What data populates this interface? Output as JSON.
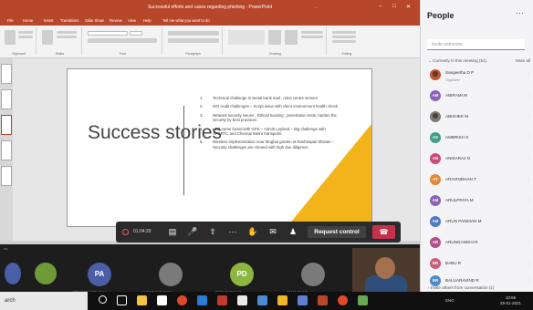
{
  "powerpoint": {
    "title": "Successful efforts and cases regarding phishing - PowerPoint",
    "user": "...",
    "tabs": [
      "Home",
      "Insert",
      "Transitions",
      "Slide Show",
      "Review",
      "View",
      "Help",
      "Tell me what you want to do"
    ],
    "ribbon_groups": [
      "Clipboard",
      "Slides",
      "Font",
      "Paragraph",
      "Drawing",
      "Editing"
    ]
  },
  "slide": {
    "title": "Success stories",
    "accent_color": "#f3b41b",
    "items": [
      {
        "num": "1.",
        "text": "Technical challenge in Serial bank mail , rules centre servers"
      },
      {
        "num": "2.",
        "text": "ISO Audit challenges – Script issue with client environment health check"
      },
      {
        "num": "3.",
        "text": "Network security issues , Ethical hacking , penetration tests, harden the security by best practices"
      },
      {
        "num": "4.",
        "text": "LED name board with GPS – Ashok Leyland – Big challenge with APSRTC and Chennai Metro transports"
      },
      {
        "num": "5.",
        "text": "Wireless implementation near Mughal garden at Rashtrapati bhavan – Security challenges are cleared with high due diligence"
      }
    ]
  },
  "meeting_controls": {
    "timer": "01:04:29",
    "request_control": "Request control"
  },
  "participants_strip": [
    {
      "initials": "PA",
      "name": "PRIYADHARSHINI A",
      "color": "#4a5fa8"
    },
    {
      "initials": "",
      "name": "MADESWAR GANA...",
      "color": "#7a7a7a"
    },
    {
      "initials": "PD",
      "name": "PARASURAM D",
      "color": "#8bb640"
    },
    {
      "initials": "",
      "name": "TAMILRAJ R",
      "color": "#7a7a7a"
    }
  ],
  "people_panel": {
    "title": "People",
    "search_placeholder": "Invite someone",
    "section_label": "Currently in this meeting (51)",
    "mute_all": "Mute all",
    "participants": [
      {
        "name": "Sangeetha D P",
        "sub": "Organizer",
        "initials": "",
        "color": "#c0552f"
      },
      {
        "name": "ABIRAMI M",
        "initials": "AM",
        "color": "#8a63b8"
      },
      {
        "name": "ABISHEK M",
        "initials": "",
        "color": "#7a7a7a"
      },
      {
        "name": "AMBRISH S",
        "initials": "AS",
        "color": "#3f9f8a"
      },
      {
        "name": "ANISARAJ N",
        "initials": "AN",
        "color": "#c84f7a"
      },
      {
        "name": "ARAVINDHAN T",
        "initials": "AT",
        "color": "#e08a3a"
      },
      {
        "name": "ARULPRIYA M",
        "initials": "AM",
        "color": "#8a63b8"
      },
      {
        "name": "ARUN PANDIAN M",
        "initials": "AM",
        "color": "#4f7ac8"
      },
      {
        "name": "ARUNGANDHI R",
        "initials": "AR",
        "color": "#b0508a"
      },
      {
        "name": "BABU R",
        "initials": "BR",
        "color": "#c95f74"
      },
      {
        "name": "BALUARAVIND R",
        "initials": "BR",
        "color": "#4f8ac8"
      }
    ],
    "footer": "Invite others from conversation (1)"
  },
  "taskbar": {
    "search": "arch",
    "tray": "ENG",
    "time": "10:56",
    "date": "25-01-2021"
  }
}
